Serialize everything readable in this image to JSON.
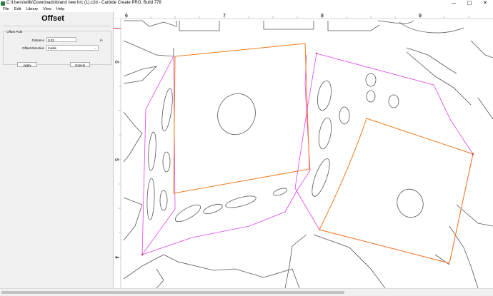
{
  "window": {
    "title": "C:\\Users\\willk\\Downloads\\brand new hrc (1).c2d - Carbide Create PRO, Build 778",
    "controls": [
      "—",
      "□",
      "✕"
    ]
  },
  "menu": [
    "File",
    "Edit",
    "Library",
    "View",
    "Help"
  ],
  "panel": {
    "title": "Offset",
    "group_label": "Offset Path",
    "distance_label": "Distance",
    "distance_value": "0.03",
    "distance_unit": "in",
    "direction_label": "Offset Direction",
    "direction_value": "Inside",
    "apply_label": "Apply",
    "cancel_label": "Cancel"
  },
  "ruler": {
    "top_labels": [
      "6",
      "7",
      "8",
      "9"
    ],
    "left_labels": [
      "6",
      "5",
      "4"
    ]
  },
  "colors": {
    "orange_path": "#f07a1a",
    "magenta_path": "#e040e8",
    "vector": "#555555"
  }
}
